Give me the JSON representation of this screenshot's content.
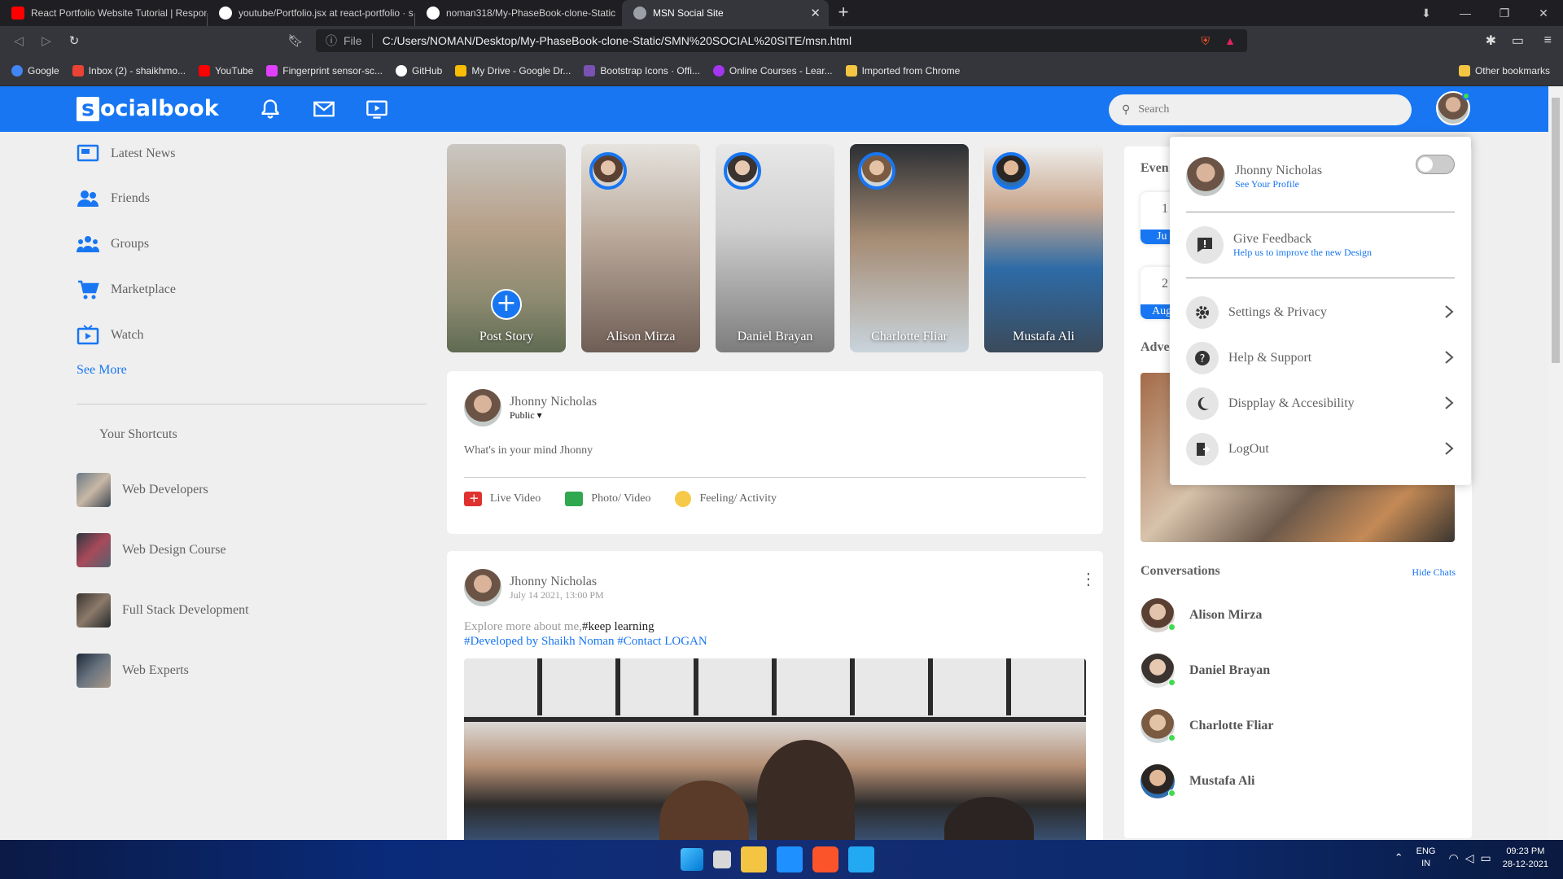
{
  "browser": {
    "tabs": [
      {
        "title": "React Portfolio Website Tutorial | Respon",
        "favicon_color": "#ff0000"
      },
      {
        "title": "youtube/Portfolio.jsx at react-portfolio · s",
        "favicon_color": "#ffffff"
      },
      {
        "title": "noman318/My-PhaseBook-clone-Static",
        "favicon_color": "#ffffff"
      },
      {
        "title": "MSN Social Site",
        "favicon_color": "#9aa0a6"
      }
    ],
    "address_prefix": "File",
    "address": "C:/Users/NOMAN/Desktop/My-PhaseBook-clone-Static/SMN%20SOCIAL%20SITE/msn.html",
    "bookmarks": [
      {
        "label": "Google",
        "color": "#4285f4"
      },
      {
        "label": "Inbox (2) - shaikhmo...",
        "color": "#ea4335"
      },
      {
        "label": "YouTube",
        "color": "#ff0000"
      },
      {
        "label": "Fingerprint sensor-sc...",
        "color": "#e040fb"
      },
      {
        "label": "GitHub",
        "color": "#ffffff"
      },
      {
        "label": "My Drive - Google Dr...",
        "color": "#fbbc04"
      },
      {
        "label": "Bootstrap Icons · Offi...",
        "color": "#7952b3"
      },
      {
        "label": "Online Courses - Lear...",
        "color": "#a435f0"
      },
      {
        "label": "Imported from Chrome",
        "color": "#f4c542"
      }
    ],
    "other_bookmarks": "Other bookmarks"
  },
  "app": {
    "logo_letter": "s",
    "logo_rest": "ocialbook",
    "search_placeholder": "Search",
    "accent": "#1876f2"
  },
  "sidebar": {
    "links": [
      {
        "label": "Latest News",
        "icon": "news-icon"
      },
      {
        "label": "Friends",
        "icon": "friends-icon"
      },
      {
        "label": "Groups",
        "icon": "groups-icon"
      },
      {
        "label": "Marketplace",
        "icon": "cart-icon"
      },
      {
        "label": "Watch",
        "icon": "watch-icon"
      }
    ],
    "see_more": "See More",
    "shortcuts_title": "Your Shortcuts",
    "shortcuts": [
      {
        "label": "Web Developers"
      },
      {
        "label": "Web Design Course"
      },
      {
        "label": "Full Stack Development"
      },
      {
        "label": "Web Experts"
      }
    ]
  },
  "stories": [
    {
      "name": "Post Story"
    },
    {
      "name": "Alison Mirza"
    },
    {
      "name": "Daniel Brayan"
    },
    {
      "name": "Charlotte Fliar"
    },
    {
      "name": "Mustafa Ali"
    }
  ],
  "composer": {
    "user": "Jhonny Nicholas",
    "privacy": "Public",
    "placeholder": "What's in your mind Jhonny",
    "actions": [
      {
        "label": "Live Video",
        "icon": "live-video-icon"
      },
      {
        "label": "Photo/ Video",
        "icon": "photo-icon"
      },
      {
        "label": "Feeling/ Activity",
        "icon": "feeling-icon"
      }
    ]
  },
  "post": {
    "user": "Jhonny Nicholas",
    "date": "July 14 2021, 13:00 PM",
    "text_plain": "Explore more about me,",
    "text_tag": "#keep learning",
    "links": "#Developed by Shaikh Noman #Contact LOGAN"
  },
  "right": {
    "events_title": "Even",
    "events": [
      {
        "day": "1",
        "month": "Ju"
      },
      {
        "day": "2",
        "month": "Aug"
      }
    ],
    "ads_title": "Adve",
    "conversations_title": "Conversations",
    "hide_chats": "Hide Chats",
    "conversations": [
      {
        "name": "Alison Mirza"
      },
      {
        "name": "Daniel Brayan"
      },
      {
        "name": "Charlotte Fliar"
      },
      {
        "name": "Mustafa Ali"
      }
    ]
  },
  "menu": {
    "user": "Jhonny Nicholas",
    "profile_link": "See Your Profile",
    "feedback_title": "Give Feedback",
    "feedback_sub": "Help us to improve the new Design",
    "items": [
      {
        "label": "Settings & Privacy",
        "icon": "settings-icon"
      },
      {
        "label": "Help & Support",
        "icon": "help-icon"
      },
      {
        "label": "Dispplay & Accesibility",
        "icon": "moon-icon"
      },
      {
        "label": "LogOut",
        "icon": "logout-icon"
      }
    ]
  },
  "taskbar": {
    "lang1": "ENG",
    "lang2": "IN",
    "time": "09:23 PM",
    "date": "28-12-2021"
  }
}
